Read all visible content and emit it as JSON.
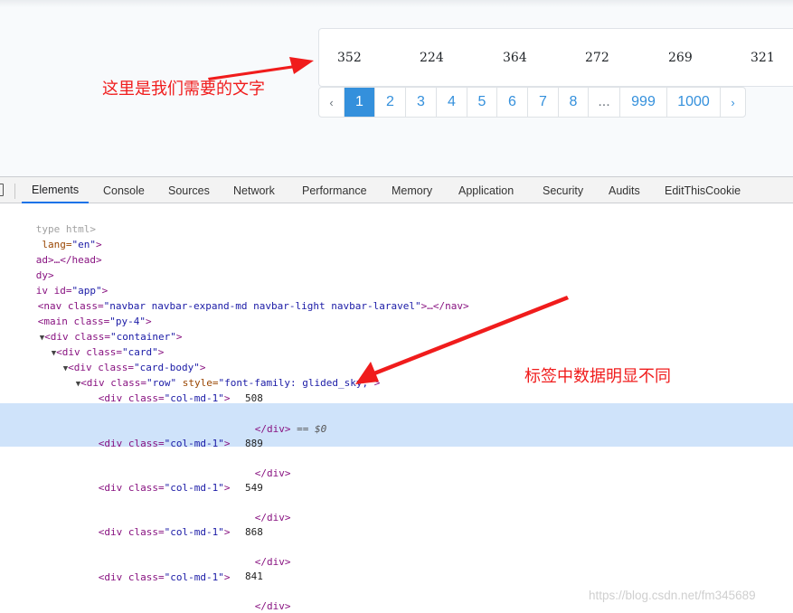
{
  "numbers": [
    "352",
    "224",
    "364",
    "272",
    "269",
    "321"
  ],
  "pagination": [
    "‹",
    "1",
    "2",
    "3",
    "4",
    "5",
    "6",
    "7",
    "8",
    "...",
    "999",
    "1000",
    "›"
  ],
  "pagination_active": "1",
  "annotation_top": "这里是我们需要的文字",
  "annotation_bottom": "标签中数据明显不同",
  "devtools_tabs": [
    "Elements",
    "Console",
    "Sources",
    "Network",
    "Performance",
    "Memory",
    "Application",
    "Security",
    "Audits",
    "EditThisCookie"
  ],
  "code": {
    "doctype": "type html>",
    "html_open": [
      " lang=",
      "\"en\"",
      ">"
    ],
    "head": "ad>…</head>",
    "body": "dy>",
    "div_app": [
      "iv id=",
      "\"app\"",
      ">"
    ],
    "nav": [
      "<nav class=",
      "\"navbar navbar-expand-md navbar-light navbar-laravel\"",
      ">…</nav>"
    ],
    "main": [
      "<main class=",
      "\"py-4\"",
      ">"
    ],
    "container": [
      "<div class=",
      "\"container\"",
      ">"
    ],
    "card": [
      "<div class=",
      "\"card\"",
      ">"
    ],
    "card_body": [
      "<div class=",
      "\"card-body\"",
      ">"
    ],
    "row": [
      "<div class=",
      "\"row\"",
      " style=",
      "\"font-family: glided_sky;\"",
      ">"
    ],
    "col_open": [
      "<div class=",
      "\"col-md-1\"",
      ">"
    ],
    "col_close": "</div>",
    "selected_marker": "== $0",
    "col_values": [
      "508",
      "889",
      "549",
      "868",
      "841"
    ]
  },
  "watermark": "https://blog.csdn.net/fm345689",
  "colors": {
    "link": "#3490dc",
    "active_bg": "#3490dc",
    "annotation": "#f01c1c",
    "highlight": "#cfe3fa",
    "tag": "#881280",
    "attr": "#994500",
    "val": "#1a1aa6"
  }
}
